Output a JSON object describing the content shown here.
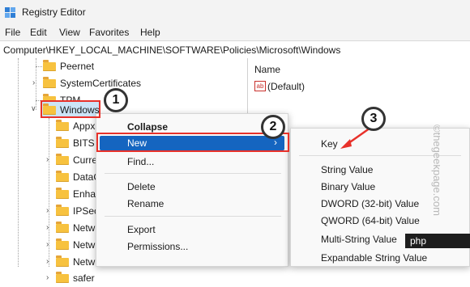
{
  "window": {
    "title": "Registry Editor"
  },
  "menubar": {
    "items": [
      "File",
      "Edit",
      "View",
      "Favorites",
      "Help"
    ]
  },
  "address": {
    "path": "Computer\\HKEY_LOCAL_MACHINE\\SOFTWARE\\Policies\\Microsoft\\Windows"
  },
  "tree": {
    "nodes": [
      {
        "label": "Peernet"
      },
      {
        "label": "SystemCertificates"
      },
      {
        "label": "TPM"
      },
      {
        "label": "Windows"
      }
    ],
    "children": [
      {
        "label": "Appx"
      },
      {
        "label": "BITS"
      },
      {
        "label": "Curre"
      },
      {
        "label": "DataC"
      },
      {
        "label": "Enhar"
      },
      {
        "label": "IPSec"
      },
      {
        "label": "Netw"
      },
      {
        "label": "Netw"
      },
      {
        "label": "Netw"
      },
      {
        "label": "safer"
      }
    ]
  },
  "values_pane": {
    "column_name": "Name",
    "default_value": "(Default)",
    "value_icon": "ab"
  },
  "context_menu": {
    "items": [
      "Collapse",
      "New",
      "Find...",
      "Delete",
      "Rename",
      "Export",
      "Permissions..."
    ],
    "highlighted": "New",
    "highlight_color": "#1565c0"
  },
  "new_submenu": {
    "items": [
      "Key",
      "String Value",
      "Binary Value",
      "DWORD (32-bit) Value",
      "QWORD (64-bit) Value",
      "Multi-String Value",
      "Expandable String Value"
    ]
  },
  "annotations": {
    "step1": "1",
    "step2": "2",
    "step3": "3",
    "accent": "#e8312a"
  },
  "watermark": {
    "text": "©thegeekpage.com"
  },
  "corner_badge": {
    "text": "php"
  }
}
